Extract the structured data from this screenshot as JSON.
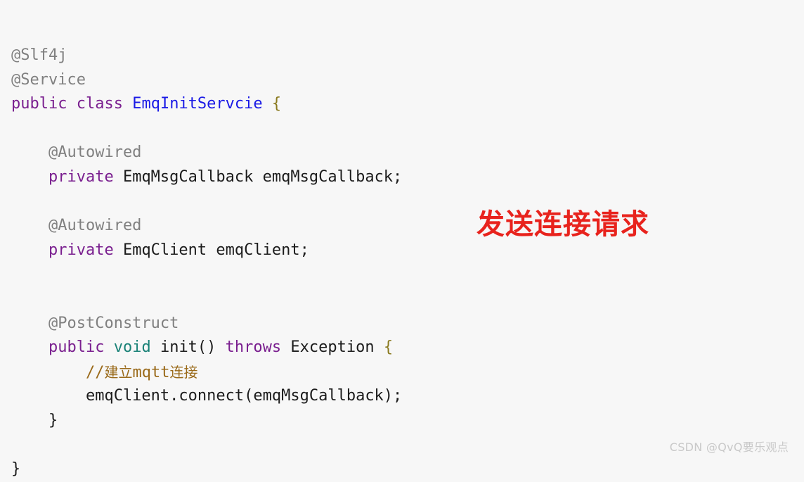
{
  "editor": {
    "background_color": "#f7f7f7",
    "font_size_px": 22,
    "language": "java",
    "colors": {
      "annotation": "#808080",
      "keyword": "#7a1f8f",
      "type_keyword": "#1a8277",
      "class_name": "#1a1ae6",
      "plain": "#1c1c1c",
      "brace": "#8a7a1f",
      "comment": "#9a6a1a"
    },
    "lines": [
      {
        "id": "line-1",
        "tokens": [
          {
            "text": "@Slf4j",
            "type": "annotation"
          }
        ]
      },
      {
        "id": "line-2",
        "tokens": [
          {
            "text": "@Service",
            "type": "annotation"
          }
        ]
      },
      {
        "id": "line-3",
        "tokens": [
          {
            "text": "public",
            "type": "keyword"
          },
          {
            "text": " ",
            "type": "plain"
          },
          {
            "text": "class",
            "type": "keyword"
          },
          {
            "text": " ",
            "type": "plain"
          },
          {
            "text": "EmqInitServcie",
            "type": "classname"
          },
          {
            "text": " ",
            "type": "plain"
          },
          {
            "text": "{",
            "type": "brace"
          }
        ]
      },
      {
        "id": "line-4",
        "tokens": [
          {
            "text": "",
            "type": "plain"
          }
        ]
      },
      {
        "id": "line-5",
        "tokens": [
          {
            "text": "    @Autowired",
            "type": "annotation"
          }
        ]
      },
      {
        "id": "line-6",
        "tokens": [
          {
            "text": "    ",
            "type": "plain"
          },
          {
            "text": "private",
            "type": "keyword"
          },
          {
            "text": " EmqMsgCallback emqMsgCallback;",
            "type": "plain"
          }
        ]
      },
      {
        "id": "line-7",
        "tokens": [
          {
            "text": "",
            "type": "plain"
          }
        ]
      },
      {
        "id": "line-8",
        "tokens": [
          {
            "text": "    @Autowired",
            "type": "annotation"
          }
        ]
      },
      {
        "id": "line-9",
        "tokens": [
          {
            "text": "    ",
            "type": "plain"
          },
          {
            "text": "private",
            "type": "keyword"
          },
          {
            "text": " EmqClient emqClient;",
            "type": "plain"
          }
        ]
      },
      {
        "id": "line-10",
        "tokens": [
          {
            "text": "",
            "type": "plain"
          }
        ]
      },
      {
        "id": "line-11",
        "tokens": [
          {
            "text": "",
            "type": "plain"
          }
        ]
      },
      {
        "id": "line-12",
        "tokens": [
          {
            "text": "    @PostConstruct",
            "type": "annotation"
          }
        ]
      },
      {
        "id": "line-13",
        "tokens": [
          {
            "text": "    ",
            "type": "plain"
          },
          {
            "text": "public",
            "type": "keyword"
          },
          {
            "text": " ",
            "type": "plain"
          },
          {
            "text": "void",
            "type": "type-kw"
          },
          {
            "text": " init() ",
            "type": "plain"
          },
          {
            "text": "throws",
            "type": "keyword"
          },
          {
            "text": " Exception ",
            "type": "plain"
          },
          {
            "text": "{",
            "type": "brace"
          }
        ]
      },
      {
        "id": "line-14",
        "tokens": [
          {
            "text": "        ",
            "type": "plain"
          },
          {
            "text": "//建立mqtt连接",
            "type": "comment"
          }
        ]
      },
      {
        "id": "line-15",
        "tokens": [
          {
            "text": "        emqClient.connect(emqMsgCallback);",
            "type": "plain"
          }
        ]
      },
      {
        "id": "line-16",
        "tokens": [
          {
            "text": "    }",
            "type": "brace-dark"
          }
        ]
      },
      {
        "id": "line-17",
        "tokens": [
          {
            "text": "",
            "type": "plain"
          }
        ]
      },
      {
        "id": "line-18",
        "tokens": [
          {
            "text": "}",
            "type": "brace-dark"
          }
        ]
      }
    ]
  },
  "annotations": {
    "red_note": {
      "text": "发送连接请求",
      "color": "#e8231d"
    }
  },
  "watermark": {
    "text": "CSDN @QvQ要乐观点",
    "color": "#c9c9c9"
  }
}
